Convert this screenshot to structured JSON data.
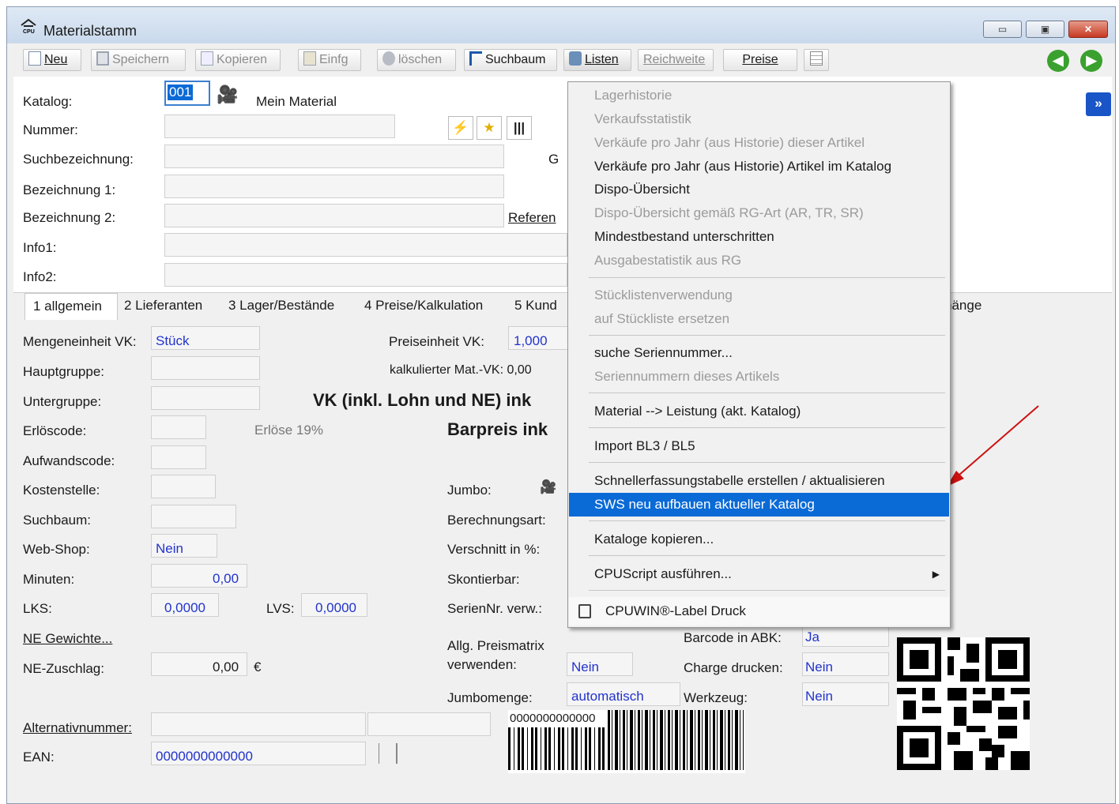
{
  "window": {
    "title": "Materialstamm",
    "app_icon": "cpu-home-icon"
  },
  "toolbar": {
    "neu": "Neu",
    "speichern": "Speichern",
    "kopieren": "Kopieren",
    "einfg": "Einfg",
    "loeschen": "löschen",
    "suchbaum": "Suchbaum",
    "listen": "Listen",
    "reichweite": "Reichweite",
    "preise": "Preise"
  },
  "header_form": {
    "katalog_label": "Katalog:",
    "katalog_value": "001",
    "katalog_name": "Mein Material",
    "nummer_label": "Nummer:",
    "suchbezeichnung_label": "Suchbezeichnung:",
    "bezeichnung1_label": "Bezeichnung 1:",
    "bezeichnung2_label": "Bezeichnung 2:",
    "info1_label": "Info1:",
    "info2_label": "Info2:",
    "g_label_partial": "G",
    "referen_link": "Referen"
  },
  "tabs": [
    "1 allgemein",
    "2 Lieferanten",
    "3 Lager/Bestände",
    "4 Preise/Kalkulation",
    "5 Kund",
    "hänge"
  ],
  "allgemein": {
    "mengeneinheit_label": "Mengeneinheit VK:",
    "mengeneinheit_value": "Stück",
    "hauptgruppe_label": "Hauptgruppe:",
    "untergruppe_label": "Untergruppe:",
    "erloescode_label": "Erlöscode:",
    "erloese_text": "Erlöse 19%",
    "aufwandscode_label": "Aufwandscode:",
    "kostenstelle_label": "Kostenstelle:",
    "suchbaum_label": "Suchbaum:",
    "webshop_label": "Web-Shop:",
    "webshop_value": "Nein",
    "minuten_label": "Minuten:",
    "minuten_value": "0,00",
    "lks_label": "LKS:",
    "lks_value": "0,0000",
    "lvs_label": "LVS:",
    "lvs_value": "0,0000",
    "ne_gewichte_link": "NE Gewichte...",
    "ne_zuschlag_label": "NE-Zuschlag:",
    "ne_zuschlag_value": "0,00",
    "ne_zuschlag_unit": "€",
    "alternativnummer_label": "Alternativnummer:",
    "ean_label": "EAN:",
    "ean_value": "0000000000000",
    "preiseinheit_label": "Preiseinheit VK:",
    "preiseinheit_value": "1,000",
    "kalk_mat_vk_text": "kalkulierter Mat.-VK: 0,00",
    "vk_inkl_text": "VK (inkl. Lohn und NE) ink",
    "barpreis_text": "Barpreis ink",
    "jumbo_label": "Jumbo:",
    "berechnungsart_label": "Berechnungsart:",
    "verschnitt_label": "Verschnitt in %:",
    "skontierbar_label": "Skontierbar:",
    "seriennr_label": "SerienNr. verw.:",
    "allg_preismatrix_label1": "Allg. Preismatrix",
    "allg_preismatrix_label2": "verwenden:",
    "allg_preismatrix_value": "Nein",
    "jumbomenge_label": "Jumbomenge:",
    "jumbomenge_value": "automatisch",
    "barcode_abk_label": "Barcode in ABK:",
    "barcode_abk_value": "Ja",
    "charge_label": "Charge drucken:",
    "charge_value": "Nein",
    "werkzeug_label": "Werkzeug:",
    "werkzeug_value": "Nein",
    "barcode_text": "0000000000000"
  },
  "menu": {
    "items": [
      {
        "label": "Lagerhistorie",
        "enabled": false
      },
      {
        "label": "Verkaufsstatistik",
        "enabled": false
      },
      {
        "label": "Verkäufe pro Jahr (aus Historie) dieser Artikel",
        "enabled": false
      },
      {
        "label": "Verkäufe pro Jahr (aus Historie) Artikel im Katalog",
        "enabled": true
      },
      {
        "label": "Dispo-Übersicht",
        "enabled": true
      },
      {
        "label": "Dispo-Übersicht gemäß RG-Art (AR, TR, SR)",
        "enabled": false
      },
      {
        "label": "Mindestbestand unterschritten",
        "enabled": true
      },
      {
        "label": "Ausgabestatistik aus RG",
        "enabled": false
      },
      {
        "label": "Stücklistenverwendung",
        "enabled": false
      },
      {
        "label": "auf Stückliste ersetzen",
        "enabled": false
      },
      {
        "label": "suche Seriennummer...",
        "enabled": true
      },
      {
        "label": "Seriennummern dieses Artikels",
        "enabled": false
      },
      {
        "label": "Material --> Leistung (akt. Katalog)",
        "enabled": true
      },
      {
        "label": "Import BL3 / BL5",
        "enabled": true
      },
      {
        "label": "Schnellerfassungstabelle erstellen / aktualisieren",
        "enabled": true
      },
      {
        "label": "SWS neu aufbauen aktueller Katalog",
        "enabled": true,
        "selected": true
      },
      {
        "label": "Kataloge kopieren...",
        "enabled": true
      },
      {
        "label": "CPUScript ausführen...",
        "enabled": true,
        "submenu": true
      },
      {
        "label": "CPUWIN®-Label Druck",
        "enabled": true
      }
    ]
  },
  "colors": {
    "accent_blue": "#0a6ad6",
    "value_blue": "#2233cc",
    "arrow_red": "#cc1111",
    "nav_green": "#3aa02e"
  }
}
